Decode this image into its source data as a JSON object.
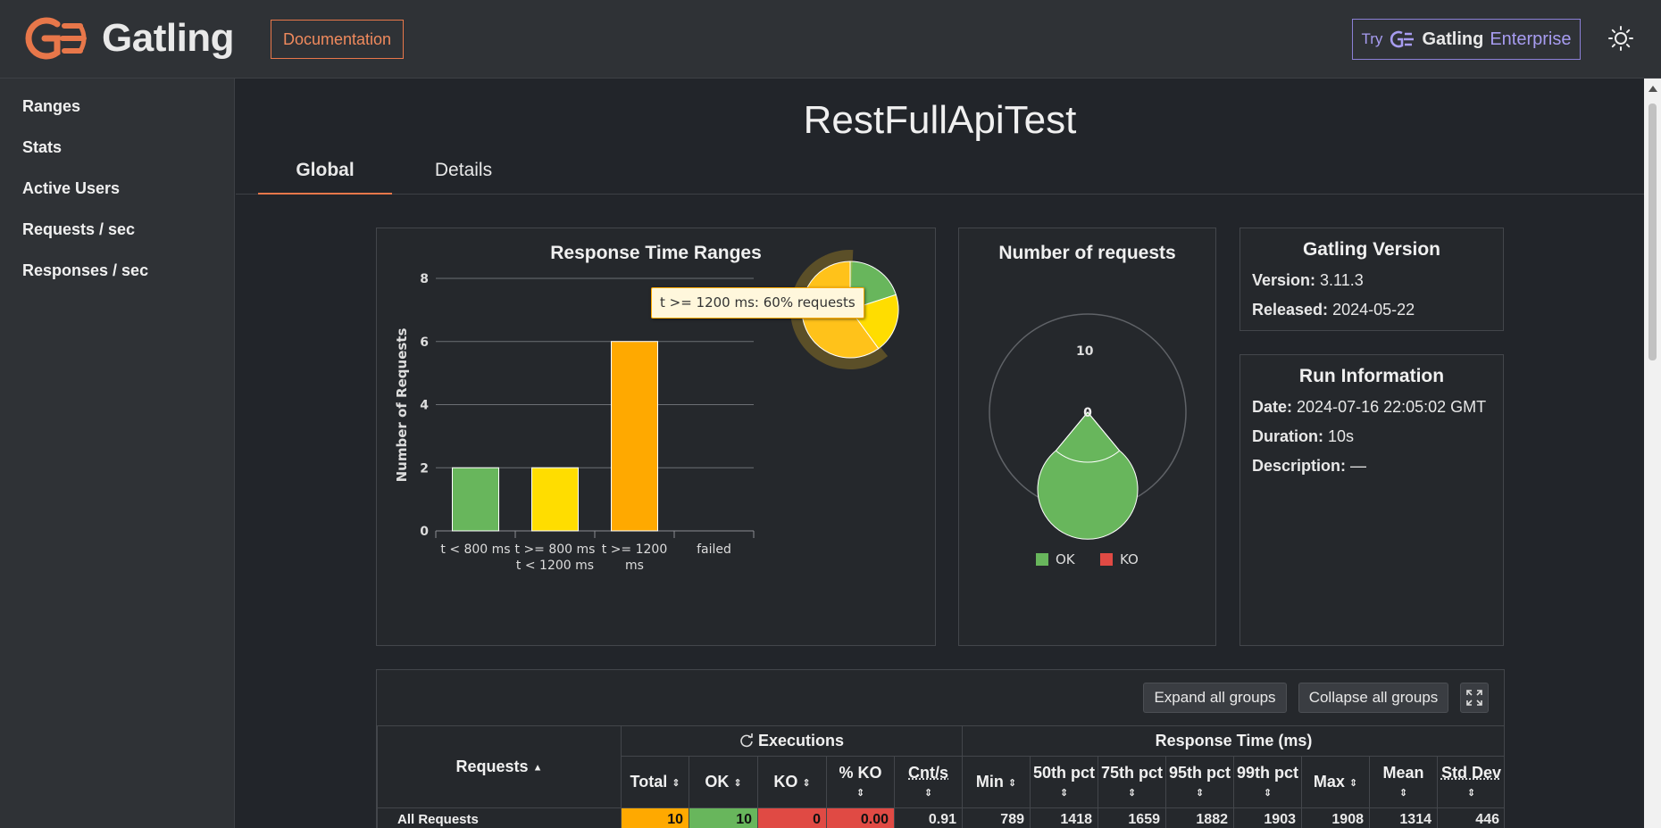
{
  "header": {
    "logo_text": "Gatling",
    "documentation_label": "Documentation",
    "enterprise": {
      "try": "Try",
      "brand": "Gatling",
      "product": "Enterprise"
    },
    "theme_icon": "sun-icon",
    "accent_color": "#e8774a"
  },
  "sidebar": {
    "items": [
      {
        "label": "Ranges"
      },
      {
        "label": "Stats"
      },
      {
        "label": "Active Users"
      },
      {
        "label": "Requests / sec"
      },
      {
        "label": "Responses / sec"
      }
    ]
  },
  "page": {
    "title": "RestFullApiTest",
    "tabs": [
      {
        "label": "Global",
        "active": true
      },
      {
        "label": "Details",
        "active": false
      }
    ]
  },
  "ranges_card": {
    "title": "Response Time Ranges",
    "tooltip": "t >= 1200 ms: 60% requests"
  },
  "requests_card": {
    "title": "Number of requests",
    "total_label": "10",
    "inner_label": "0",
    "legend": [
      {
        "label": "OK",
        "color": "#68b65c"
      },
      {
        "label": "KO",
        "color": "#e04a44"
      }
    ]
  },
  "version_card": {
    "title": "Gatling Version",
    "version_label": "Version:",
    "version": "3.11.3",
    "released_label": "Released:",
    "released": "2024-05-22"
  },
  "run_card": {
    "title": "Run Information",
    "date_label": "Date:",
    "date": "2024-07-16 22:05:02 GMT",
    "duration_label": "Duration:",
    "duration": "10s",
    "description_label": "Description:",
    "description": "—"
  },
  "chart_data": [
    {
      "type": "bar",
      "title": "Response Time Ranges",
      "ylabel": "Number of Requests",
      "xlabel": "",
      "categories": [
        [
          "t < 800 ms"
        ],
        [
          "t >= 800 ms",
          "t < 1200 ms"
        ],
        [
          "t >= 1200",
          "ms"
        ],
        [
          "failed"
        ]
      ],
      "values": [
        2,
        2,
        6,
        0
      ],
      "colors": [
        "#68b65c",
        "#ffdd00",
        "#ffa900",
        "#e04a44"
      ],
      "ylim": [
        0,
        8
      ],
      "yticks": [
        0,
        2,
        4,
        6,
        8
      ],
      "grid": true
    },
    {
      "type": "pie",
      "title": "",
      "slices": [
        {
          "label": "t < 800 ms",
          "value": 20,
          "color": "#68b65c"
        },
        {
          "label": "t >= 800 ms t < 1200 ms",
          "value": 20,
          "color": "#ffdd00"
        },
        {
          "label": "t >= 1200 ms",
          "value": 60,
          "color": "#ffc21a"
        }
      ]
    },
    {
      "type": "pie",
      "title": "Number of requests",
      "slices": [
        {
          "label": "OK",
          "value": 10,
          "color": "#68b65c"
        },
        {
          "label": "KO",
          "value": 0,
          "color": "#e04a44"
        }
      ]
    }
  ],
  "stats": {
    "expand_label": "Expand all groups",
    "collapse_label": "Collapse all groups",
    "fullscreen_icon": "fullscreen-icon",
    "executions_label": "Executions",
    "response_time_label": "Response Time (ms)",
    "requests_label": "Requests",
    "columns": [
      "Total",
      "OK",
      "KO",
      "% KO",
      "Cnt/s",
      "Min",
      "50th pct",
      "75th pct",
      "95th pct",
      "99th pct",
      "Max",
      "Mean",
      "Std Dev"
    ],
    "row": {
      "name": "All Requests",
      "values": [
        "10",
        "10",
        "0",
        "0.00",
        "0.91",
        "789",
        "1418",
        "1659",
        "1882",
        "1903",
        "1908",
        "1314",
        "446"
      ],
      "colors": [
        "#ffa900",
        "#68b65c",
        "#e04a44",
        "#e04a44",
        "",
        "",
        "",
        "",
        "",
        "",
        "",
        "",
        ""
      ]
    }
  }
}
